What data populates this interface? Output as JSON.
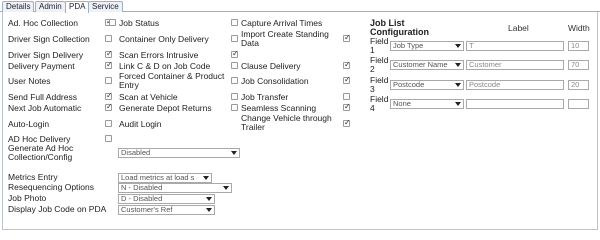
{
  "tabs": [
    "Details",
    "Admin",
    "PDA",
    "Service"
  ],
  "col1": [
    {
      "label": "Ad. Hoc Collection",
      "checked": true
    },
    {
      "label": "Driver Sign Collection",
      "checked": false
    },
    {
      "label": "Driver Sign Delivery",
      "checked": true
    },
    {
      "label": "Delivery Payment",
      "checked": true
    },
    {
      "label": "User Notes",
      "checked": false
    },
    {
      "label": "Send Full Address",
      "checked": true
    },
    {
      "label": "Next Job Automatic",
      "checked": true
    },
    {
      "label": "Auto-Login",
      "checked": false
    },
    {
      "label": "AD Hoc Delivery",
      "checked": false
    }
  ],
  "col2": [
    {
      "label": "Job Status",
      "checked": false
    },
    {
      "label": "Container Only Delivery",
      "checked": false
    },
    {
      "label": "Scan Errors Intrusive",
      "checked": true
    },
    {
      "label": "Link C & D on Job Code",
      "checked": false
    },
    {
      "label": "Forced Container & Product Entry",
      "checked": false
    },
    {
      "label": "Scan at Vehicle",
      "checked": false
    },
    {
      "label": "Generate Depot Returns",
      "checked": false
    },
    {
      "label": "Audit Login",
      "checked": false
    }
  ],
  "col3": [
    {
      "label": "Capture Arrival Times",
      "checked": false
    },
    {
      "label": "Import Create Standing Data",
      "checked": true
    },
    {
      "label": "Clause Delivery",
      "checked": true
    },
    {
      "label": "Job Consolidation",
      "checked": true
    },
    {
      "label": "Job Transfer",
      "checked": false
    },
    {
      "label": "Seamless Scanning",
      "checked": true
    },
    {
      "label": "Change Vehicle through Trailer",
      "checked": true
    }
  ],
  "generate_adhoc": {
    "label": "Generate Ad Hoc Collection/Config",
    "value": "Disabled"
  },
  "bottom_selects": [
    {
      "label": "Metrics Entry",
      "value": "Load metrics at load s"
    },
    {
      "label": "Resequencing Options",
      "value": "N - Disabled"
    },
    {
      "label": "Job Photo",
      "value": "D - Disabled"
    },
    {
      "label": "Display Job Code on PDA",
      "value": "Customer's Ref"
    }
  ],
  "job_list": {
    "title": "Job List Configuration",
    "label_header": "Label",
    "width_header": "Width",
    "fields": [
      {
        "name": "Field 1",
        "type": "Job Type",
        "label": "T",
        "width": "10"
      },
      {
        "name": "Field 2",
        "type": "Customer Name",
        "label": "Customer",
        "width": "70"
      },
      {
        "name": "Field 3",
        "type": "Postcode",
        "label": "Postcode",
        "width": "20"
      },
      {
        "name": "Field 4",
        "type": "None",
        "label": "",
        "width": ""
      }
    ]
  }
}
